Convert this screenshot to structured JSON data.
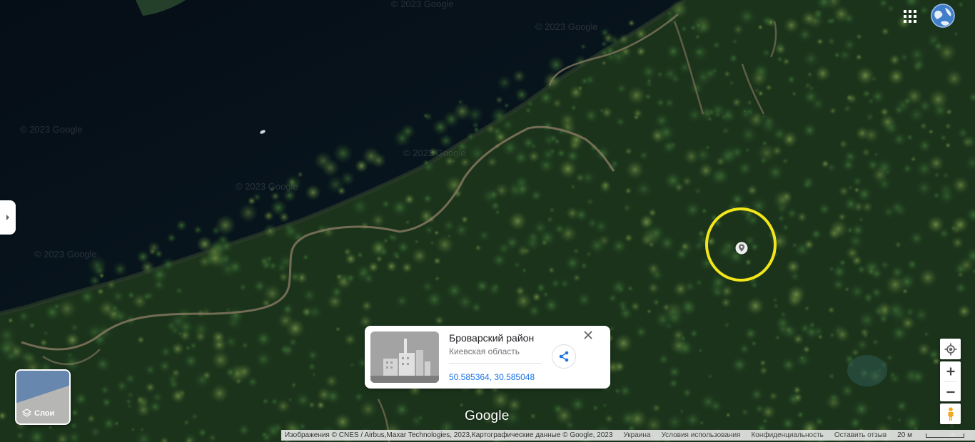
{
  "map": {
    "watermark": "© 2023 Google",
    "logo": "Google"
  },
  "place_card": {
    "title": "Броварский район",
    "subtitle": "Киевская область",
    "coordinates": "50.585364, 30.585048"
  },
  "layers": {
    "label": "Слои"
  },
  "footer": {
    "attribution": "Изображения © CNES / Airbus,Maxar Technologies, 2023,Картографические данные © Google, 2023",
    "country": "Украина",
    "terms": "Условия использования",
    "privacy": "Конфиденциальность",
    "feedback": "Оставить отзыв",
    "scale": "20 м"
  },
  "colors": {
    "highlight_circle": "#f2e61a",
    "coordinate_link": "#1a73e8",
    "water": "#07111a",
    "forest": "#1c3a1c"
  },
  "icons": [
    "chevron-right-icon",
    "apps-grid-icon",
    "globe-avatar-icon",
    "location-pin-icon",
    "share-icon",
    "close-icon",
    "layers-icon",
    "my-location-icon",
    "plus-icon",
    "minus-icon",
    "pegman-icon"
  ]
}
